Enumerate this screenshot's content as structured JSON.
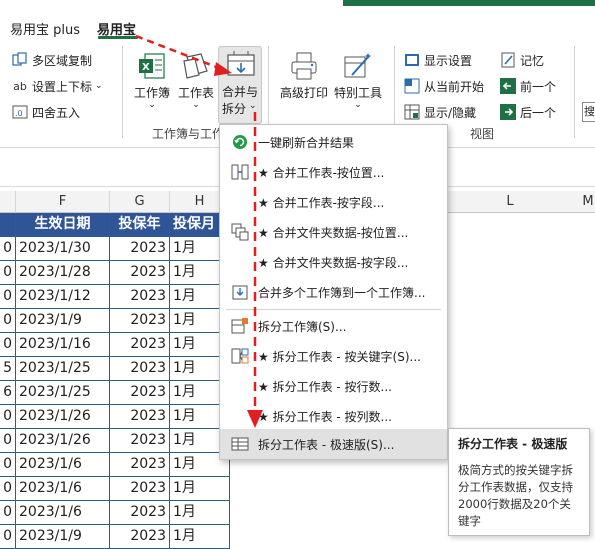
{
  "tabs": [
    {
      "label": "易用宝 plus",
      "active": false
    },
    {
      "label": "易用宝",
      "active": true
    }
  ],
  "ribbon": {
    "multi_area_copy": "多区域复制",
    "set_dropdown": "设置上下标",
    "round": "四舍五入",
    "workbook": "工作簿",
    "worksheet": "工作表",
    "merge_split_line1": "合并与",
    "merge_split_line2": "拆分",
    "group_workbook_label": "工作簿与工作表",
    "advanced_print": "高级打印",
    "special_tools": "特别工具",
    "show_settings": "显示设置",
    "from_current": "从当前开始",
    "show_hide": "显示/隐藏",
    "group_view_label": "视图",
    "memory": "记忆",
    "prev": "前一个",
    "next": "后一个",
    "search_char": "搜"
  },
  "columns": {
    "F": "F",
    "G": "G",
    "H": "H",
    "L": "L",
    "M": "M"
  },
  "table": {
    "headers": [
      "生效日期",
      "投保年",
      "投保月"
    ],
    "rows": [
      {
        "a": "0",
        "date": "2023/1/30",
        "year": "2023",
        "month": "1月"
      },
      {
        "a": "0",
        "date": "2023/1/28",
        "year": "2023",
        "month": "1月"
      },
      {
        "a": "0",
        "date": "2023/1/12",
        "year": "2023",
        "month": "1月"
      },
      {
        "a": "0",
        "date": "2023/1/9",
        "year": "2023",
        "month": "1月"
      },
      {
        "a": "0",
        "date": "2023/1/16",
        "year": "2023",
        "month": "1月"
      },
      {
        "a": "5",
        "date": "2023/1/25",
        "year": "2023",
        "month": "1月"
      },
      {
        "a": "6",
        "date": "2023/1/25",
        "year": "2023",
        "month": "1月"
      },
      {
        "a": "0",
        "date": "2023/1/26",
        "year": "2023",
        "month": "1月"
      },
      {
        "a": "0",
        "date": "2023/1/26",
        "year": "2023",
        "month": "1月"
      },
      {
        "a": "0",
        "date": "2023/1/6",
        "year": "2023",
        "month": "1月"
      },
      {
        "a": "0",
        "date": "2023/1/6",
        "year": "2023",
        "month": "1月"
      },
      {
        "a": "0",
        "date": "2023/1/6",
        "year": "2023",
        "month": "1月"
      },
      {
        "a": "0",
        "date": "2023/1/9",
        "year": "2023",
        "month": "1月"
      }
    ]
  },
  "menu": {
    "items": [
      {
        "label": "一键刷新合并结果",
        "icon": "refresh-icon"
      },
      {
        "label": "★ 合并工作表-按位置...",
        "icon": "merge-sheets-icon"
      },
      {
        "label": "★ 合并工作表-按字段...",
        "icon": ""
      },
      {
        "label": "★ 合并文件夹数据-按位置...",
        "icon": "merge-folder-icon"
      },
      {
        "label": "★ 合并文件夹数据-按字段...",
        "icon": ""
      },
      {
        "label": "合并多个工作簿到一个工作簿...",
        "icon": "merge-workbooks-icon"
      },
      {
        "label": "拆分工作簿(S)...",
        "icon": "split-workbook-icon"
      },
      {
        "label": "★ 拆分工作表 - 按关键字(S)...",
        "icon": "split-by-key-icon"
      },
      {
        "label": "★ 拆分工作表 - 按行数...",
        "icon": ""
      },
      {
        "label": "★ 拆分工作表 - 按列数...",
        "icon": ""
      },
      {
        "label": "拆分工作表 - 极速版(S)...",
        "icon": "split-fast-icon"
      }
    ]
  },
  "tooltip": {
    "title": "拆分工作表 - 极速版",
    "body": "极简方式的按关键字拆分工作表数据，仅支持2000行数据及20个关键字"
  },
  "colors": {
    "excel_green": "#1e7145",
    "table_header_blue": "#2f5597",
    "arrow_red": "#e21f1f"
  }
}
